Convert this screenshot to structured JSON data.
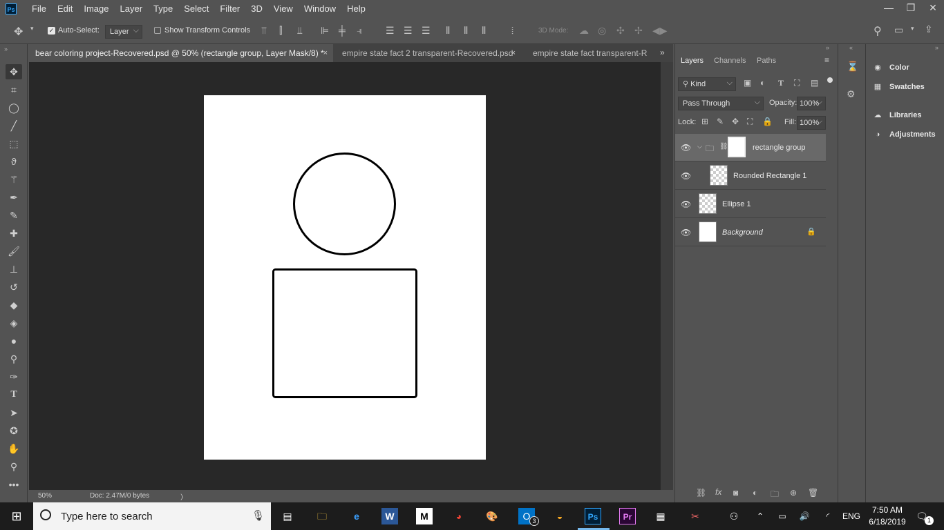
{
  "app": {
    "logo_text": "Ps"
  },
  "menu": [
    "File",
    "Edit",
    "Image",
    "Layer",
    "Type",
    "Select",
    "Filter",
    "3D",
    "View",
    "Window",
    "Help"
  ],
  "window_controls": {
    "minimize": "—",
    "restore": "❐",
    "close": "✕"
  },
  "options": {
    "auto_select_label": "Auto-Select:",
    "auto_select_value": "Layer",
    "show_transform_label": "Show Transform Controls",
    "mode_3d_label": "3D Mode:"
  },
  "tabs": [
    {
      "label": "bear coloring project-Recovered.psd @ 50% (rectangle group, Layer Mask/8) *",
      "close": "×"
    },
    {
      "label": "empire state fact 2 transparent-Recovered.psd",
      "close": "×"
    },
    {
      "label": "empire state fact transparent-R",
      "close": ""
    }
  ],
  "status": {
    "zoom": "50%",
    "doc": "Doc: 2.47M/0 bytes",
    "arrow": "〉"
  },
  "layers_panel": {
    "tabs": [
      "Layers",
      "Channels",
      "Paths"
    ],
    "filter_value": "Kind",
    "blend_mode": "Pass Through",
    "opacity_label": "Opacity:",
    "opacity_value": "100%",
    "lock_label": "Lock:",
    "fill_label": "Fill:",
    "fill_value": "100%",
    "layers": [
      {
        "name": "rectangle group"
      },
      {
        "name": "Rounded Rectangle 1"
      },
      {
        "name": "Ellipse 1"
      },
      {
        "name": "Background"
      }
    ]
  },
  "right_panel": {
    "items": [
      {
        "label": "Color",
        "icon": "color-icon"
      },
      {
        "label": "Swatches",
        "icon": "swatches-icon"
      },
      {
        "label": "Libraries",
        "icon": "libraries-icon"
      },
      {
        "label": "Adjustments",
        "icon": "adjustments-icon"
      }
    ]
  },
  "taskbar": {
    "search_placeholder": "Type here to search",
    "time": "7:50 AM",
    "date": "6/18/2019",
    "language": "ENG",
    "outlook_badge": "3",
    "notification_badge": "1"
  },
  "colors": {
    "panel": "#535353",
    "canvas": "#282828",
    "selected_layer": "#696969",
    "taskbar": "#1c1c1c"
  }
}
